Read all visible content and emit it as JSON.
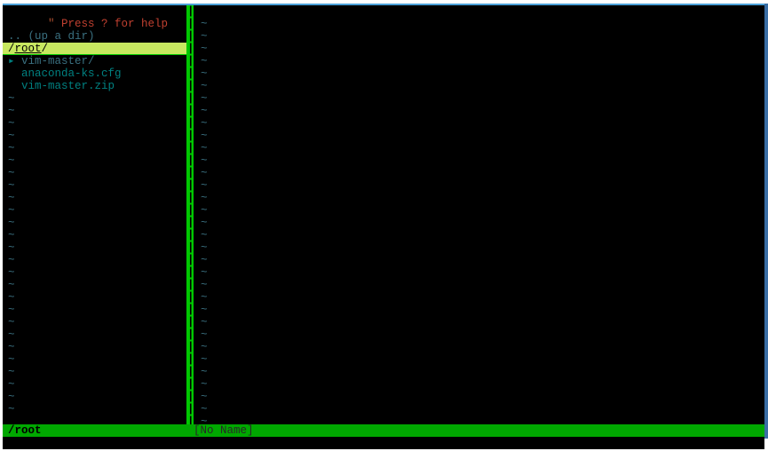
{
  "help": {
    "star": "\"",
    "text": " Press ? for help"
  },
  "blank": "",
  "updir": ".. (up a dir)",
  "cwd": {
    "slash1": "/",
    "name": "root",
    "slash2": "/"
  },
  "tree": {
    "arrow": "▸",
    "items": [
      {
        "name": "vim-master/",
        "type": "dir"
      },
      {
        "name": "anaconda-ks.cfg",
        "type": "file"
      },
      {
        "name": "vim-master.zip",
        "type": "file"
      }
    ]
  },
  "tilde": "~",
  "vsplit_char": "|",
  "status": {
    "left": "/root",
    "right": "[No Name]"
  }
}
